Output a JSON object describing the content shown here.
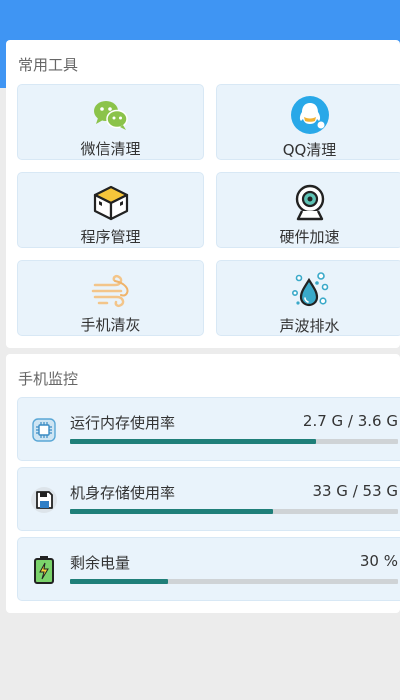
{
  "tools": {
    "title": "常用工具",
    "items": [
      {
        "label": "微信清理",
        "icon": "wechat-icon"
      },
      {
        "label": "QQ清理",
        "icon": "qq-icon"
      },
      {
        "label": "程序管理",
        "icon": "box-icon"
      },
      {
        "label": "硬件加速",
        "icon": "camera-icon"
      },
      {
        "label": "手机清灰",
        "icon": "wind-icon"
      },
      {
        "label": "声波排水",
        "icon": "water-drop-icon"
      }
    ]
  },
  "monitor": {
    "title": "手机监控",
    "items": [
      {
        "label": "运行内存使用率",
        "value": "2.7 G / 3.6 G",
        "usage": 0.75,
        "icon": "chip-icon"
      },
      {
        "label": "机身存储使用率",
        "value": "33 G / 53 G",
        "usage": 0.62,
        "icon": "storage-icon"
      },
      {
        "label": "剩余电量",
        "value": "30 %",
        "usage": 0.3,
        "icon": "battery-icon"
      }
    ]
  },
  "colors": {
    "header": "#3f95f3",
    "progress": "#1f7f79",
    "tile_bg": "#e9f3fb"
  }
}
